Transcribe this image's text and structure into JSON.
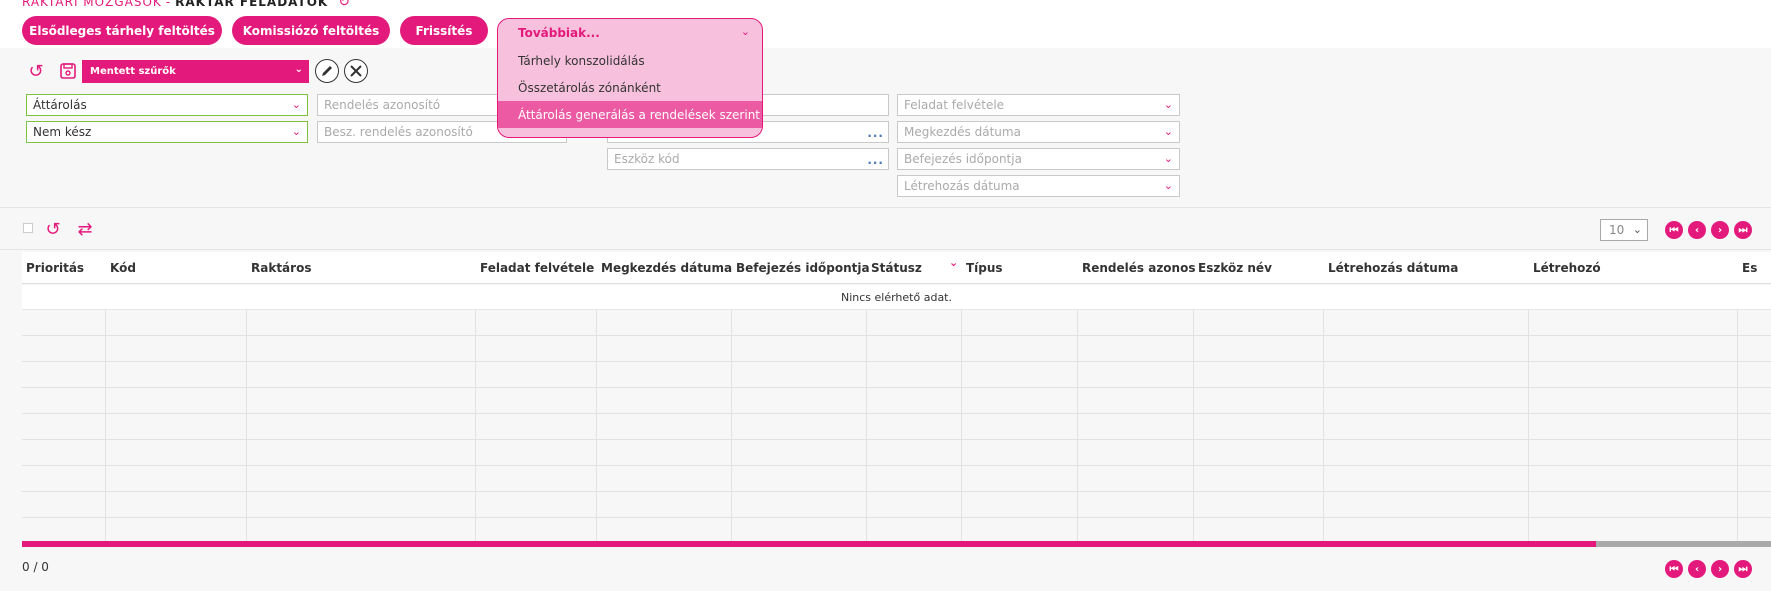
{
  "breadcrumb": {
    "parent": "RAKTÁRI MOZGÁSOK",
    "separator": "-",
    "current": "RAKTÁR FELADATOK"
  },
  "top_buttons": [
    {
      "label": "Elsődleges tárhely feltöltés"
    },
    {
      "label": "Komissiózó feltöltés"
    },
    {
      "label": "Frissítés"
    }
  ],
  "more_menu": {
    "label": "Továbbiak...",
    "items": [
      {
        "label": "Tárhely konszolidálás"
      },
      {
        "label": "Összetárolás zónánként"
      },
      {
        "label": "Áttárolás generálás a rendelések szerint"
      }
    ],
    "active_index": 2
  },
  "saved_filters": {
    "label": "Mentett szűrők"
  },
  "filters": {
    "type_value": "Áttárolás",
    "status_value": "Nem kész",
    "order_id_placeholder": "Rendelés azonosító",
    "purchase_order_placeholder": "Besz. rendelés azonosító",
    "device_code_placeholder": "Eszköz kód",
    "task_pickup_placeholder": "Feladat felvétele",
    "start_date_placeholder": "Megkezdés dátuma",
    "finish_time_placeholder": "Befejezés időpontja",
    "created_date_placeholder": "Létrehozás dátuma"
  },
  "pagination": {
    "page_size": "10",
    "counter": "0  /  0"
  },
  "table": {
    "columns": [
      "Prioritás",
      "Kód",
      "Raktáros",
      "Feladat felvétele",
      "Megkezdés dátuma",
      "Befejezés időpontja",
      "Státusz",
      "Típus",
      "Rendelés azonosító",
      "Eszköz név",
      "Létrehozás dátuma",
      "Létrehozó",
      "Es"
    ],
    "empty_message": "Nincs elérhető adat.",
    "scroll_fraction": 0.9
  },
  "colors": {
    "accent": "#e4197c",
    "accent_light": "#f7c1dd",
    "valid_border": "#7dc241"
  }
}
